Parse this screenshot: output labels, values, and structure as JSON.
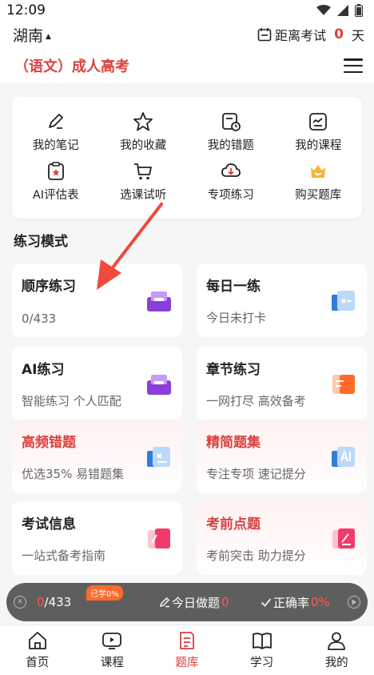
{
  "status_bar": {
    "time": "12:09"
  },
  "header": {
    "region": "湖南",
    "exam_label_before": "距离考试",
    "exam_days": "0",
    "exam_label_after": "天"
  },
  "subject": {
    "title": "（语文）成人高考"
  },
  "quick_links": [
    {
      "label": "我的笔记",
      "icon": "pen-note-icon"
    },
    {
      "label": "我的收藏",
      "icon": "star-icon"
    },
    {
      "label": "我的错题",
      "icon": "wrong-questions-icon"
    },
    {
      "label": "我的课程",
      "icon": "course-icon"
    },
    {
      "label": "AI评估表",
      "icon": "ai-evaluation-icon"
    },
    {
      "label": "选课试听",
      "icon": "cart-icon"
    },
    {
      "label": "专项练习",
      "icon": "download-cloud-icon"
    },
    {
      "label": "购买题库",
      "icon": "crown-bag-icon"
    }
  ],
  "section": {
    "title": "练习模式"
  },
  "modes": [
    {
      "title": "顺序练习",
      "sub": "0/433",
      "icon": "purple-box-icon",
      "pink": false
    },
    {
      "title": "每日一练",
      "sub": "今日未打卡",
      "icon": "blue-calendar-icon",
      "pink": false
    },
    {
      "title": "AI练习",
      "sub": "智能练习 个人匹配",
      "icon": "purple-box-icon",
      "pink": false
    },
    {
      "title": "章节练习",
      "sub": "一网打尽 高效备考",
      "icon": "orange-chapter-icon",
      "pink": false
    },
    {
      "title": "高频错题",
      "sub": "优选35% 易错题集",
      "icon": "blue-wrong-icon",
      "pink": true
    },
    {
      "title": "精简题集",
      "sub": "专注专项 速记提分",
      "icon": "blue-ai-icon",
      "pink": true
    },
    {
      "title": "考试信息",
      "sub": "一站式备考指南",
      "icon": "pink-doc-icon",
      "pink": false
    },
    {
      "title": "考前点题",
      "sub": "考前突击 助力提分",
      "icon": "pink-pen-icon",
      "pink": true
    }
  ],
  "progress": {
    "done": "0",
    "total": "/433",
    "studied_badge": "已学0%",
    "today_label": "今日做题",
    "today_value": "0",
    "accuracy_label": "正确率",
    "accuracy_value": "0%"
  },
  "nav": [
    {
      "label": "首页",
      "icon": "home-icon",
      "active": false
    },
    {
      "label": "课程",
      "icon": "play-course-icon",
      "active": false
    },
    {
      "label": "题库",
      "icon": "question-bank-icon",
      "active": true
    },
    {
      "label": "学习",
      "icon": "book-icon",
      "active": false
    },
    {
      "label": "我的",
      "icon": "user-icon",
      "active": false
    }
  ],
  "colors": {
    "accent": "#d9423f",
    "purple": "#8b3fd9",
    "blue": "#2f7de1",
    "orange": "#ff6a2b"
  }
}
